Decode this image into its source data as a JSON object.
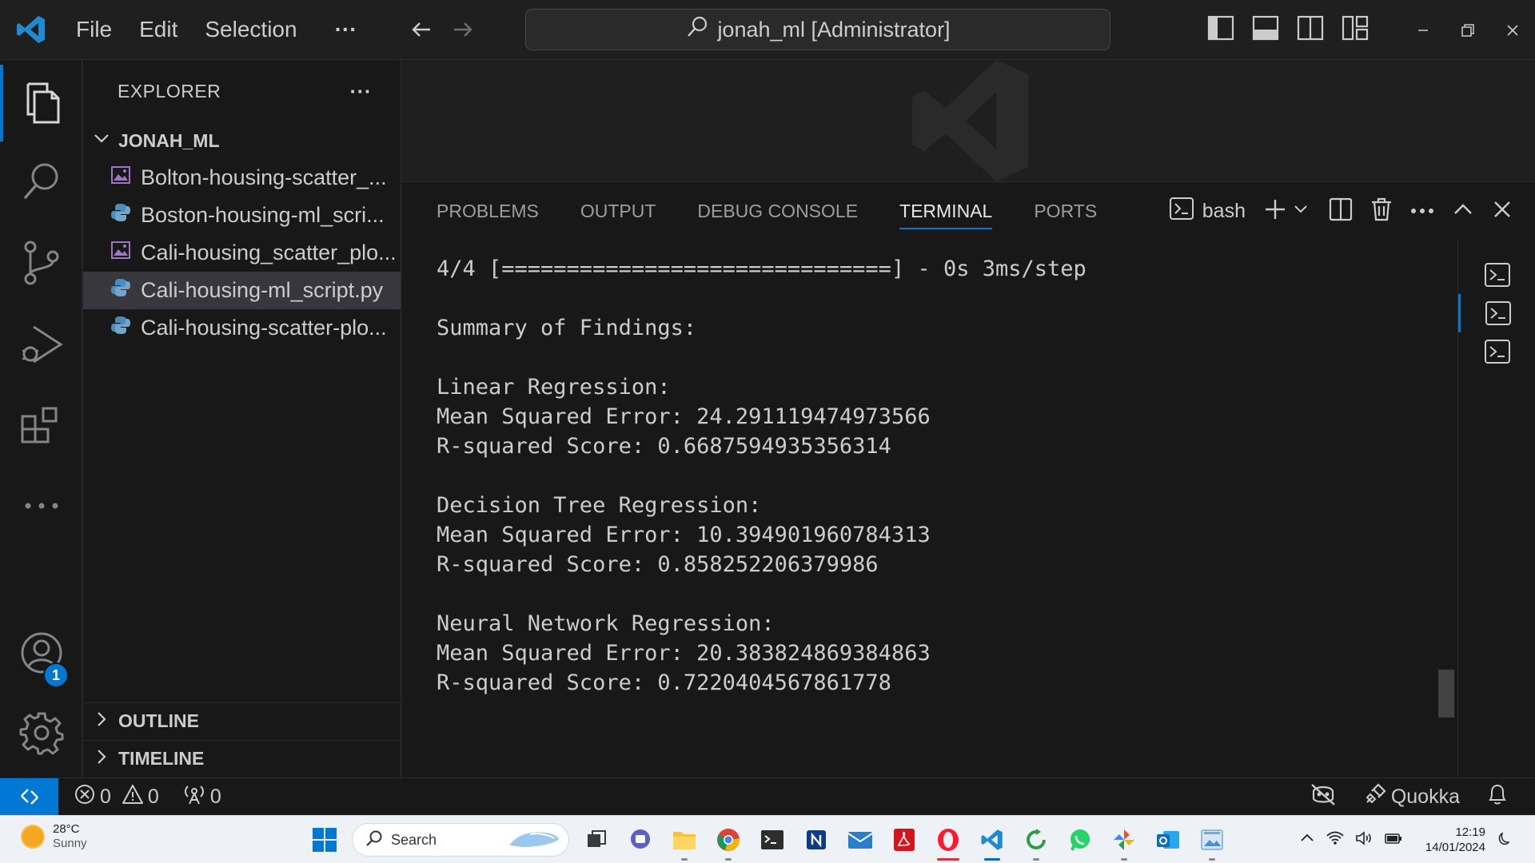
{
  "titlebar": {
    "menu": [
      "File",
      "Edit",
      "Selection",
      "···"
    ],
    "search_text": "jonah_ml [Administrator]"
  },
  "activity": {
    "account_badge": "1"
  },
  "explorer": {
    "header": "EXPLORER",
    "more": "···",
    "folder": "JONAH_ML",
    "files": [
      {
        "name": "Bolton-housing-scatter_...",
        "type": "image"
      },
      {
        "name": "Boston-housing-ml_scri...",
        "type": "python"
      },
      {
        "name": "Cali-housing_scatter_plo...",
        "type": "image"
      },
      {
        "name": "Cali-housing-ml_script.py",
        "type": "python",
        "selected": true
      },
      {
        "name": "Cali-housing-scatter-plo...",
        "type": "python"
      }
    ],
    "outline": "OUTLINE",
    "timeline": "TIMELINE"
  },
  "panel": {
    "tabs": [
      "PROBLEMS",
      "OUTPUT",
      "DEBUG CONSOLE",
      "TERMINAL",
      "PORTS"
    ],
    "active_tab": "TERMINAL",
    "shell": "bash"
  },
  "terminal": {
    "lines": [
      "4/4 [==============================] - 0s 3ms/step",
      "",
      "Summary of Findings:",
      "",
      "Linear Regression:",
      "Mean Squared Error: 24.291119474973566",
      "R-squared Score: 0.6687594935356314",
      "",
      "Decision Tree Regression:",
      "Mean Squared Error: 10.394901960784313",
      "R-squared Score: 0.858252206379986",
      "",
      "Neural Network Regression:",
      "Mean Squared Error: 20.383824869384863",
      "R-squared Score: 0.7220404567861778"
    ]
  },
  "statusbar": {
    "errors": "0",
    "warnings": "0",
    "ports": "0",
    "quokka": "Quokka"
  },
  "taskbar": {
    "temperature": "28°C",
    "condition": "Sunny",
    "search_placeholder": "Search",
    "time": "12:19",
    "date": "14/01/2024"
  },
  "colors": {
    "accent": "#0078d4",
    "background": "#1f1f1f",
    "sidebar": "#181818"
  }
}
